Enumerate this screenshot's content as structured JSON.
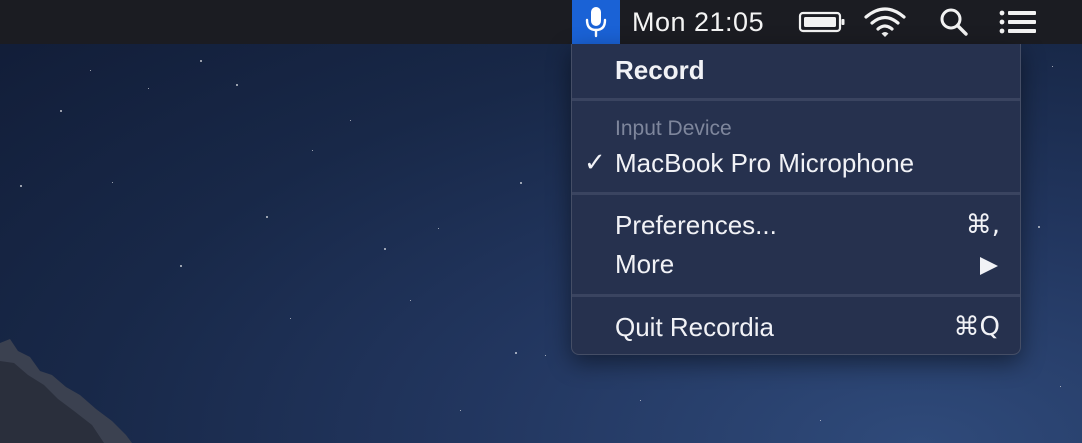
{
  "menubar": {
    "clock": "Mon 21:05",
    "icons": [
      "microphone-icon",
      "battery-icon",
      "wifi-icon",
      "search-icon",
      "list-icon"
    ],
    "accent_color": "#1a62d6"
  },
  "menu": {
    "record_label": "Record",
    "input_device_header": "Input Device",
    "microphone_label": "MacBook Pro Microphone",
    "microphone_selected": true,
    "preferences_label": "Preferences...",
    "preferences_shortcut": "⌘,",
    "more_label": "More",
    "quit_label": "Quit Recordia",
    "quit_shortcut": "⌘Q"
  }
}
